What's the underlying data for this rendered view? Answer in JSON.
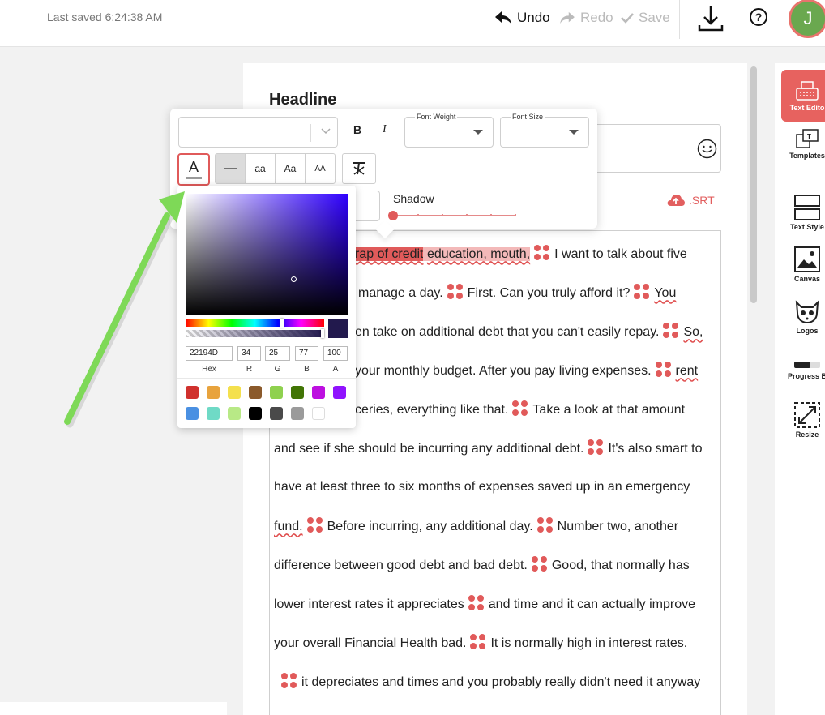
{
  "topbar": {
    "last_saved": "Last saved 6:24:38 AM",
    "undo": "Undo",
    "redo": "Redo",
    "save": "Save",
    "avatar_initial": "J"
  },
  "editor": {
    "headline_label": "Headline",
    "srt_label": ".SRT",
    "lines": [
      [
        "rap of credit",
        "education, mouth,",
        "I want to talk about five"
      ],
      [
        "manage a day.",
        "First. Can you truly afford it?",
        "You"
      ],
      [
        "en take on additional debt that you can't easily repay.",
        "So,"
      ],
      [
        "your monthly budget. After you pay living expenses.",
        "rent"
      ],
      [
        "ceries, everything like that.",
        "Take a look at that amount"
      ],
      [
        "and see if she should be incurring any additional debt.",
        "It's also smart to"
      ],
      [
        "have at least three to six months of expenses saved up in an emergency"
      ],
      [
        "fund.",
        "Before incurring, any additional day.",
        "Number two, another"
      ],
      [
        "difference between good debt and bad debt.",
        "Good, that normally has"
      ],
      [
        "lower interest rates it appreciates",
        "and time and it can actually improve"
      ],
      [
        "your overall Financial Health bad.",
        "It is normally high in interest rates."
      ],
      [
        "it depreciates and times and you probably really didn't need it anyway"
      ]
    ]
  },
  "toolbar": {
    "font_weight_label": "Font Weight",
    "font_size_label": "Font Size",
    "bold": "B",
    "italic": "I",
    "color_button": "A",
    "case_options": [
      "—",
      "aa",
      "Aa",
      "AA"
    ],
    "shadow_label": "Shadow"
  },
  "color_picker": {
    "hex": "22194D",
    "r": "34",
    "g": "25",
    "b": "77",
    "a": "100",
    "labels": [
      "Hex",
      "R",
      "G",
      "B",
      "A"
    ],
    "swatches": [
      "#d0312d",
      "#e8a33d",
      "#f4e04d",
      "#8b5a2b",
      "#8fd14f",
      "#417505",
      "#bd10e0",
      "#9013fe",
      "#4a90e2",
      "#6fdac6",
      "#b8e986",
      "#000000",
      "#4a4a4a",
      "#9b9b9b",
      "#ffffff"
    ]
  },
  "right_tools": [
    "Text Edito",
    "Templates",
    "Text Style",
    "Canvas",
    "Logos",
    "Progress B",
    "Resize"
  ],
  "colors": {
    "accent": "#e7625f",
    "arrow": "#7ed957"
  }
}
